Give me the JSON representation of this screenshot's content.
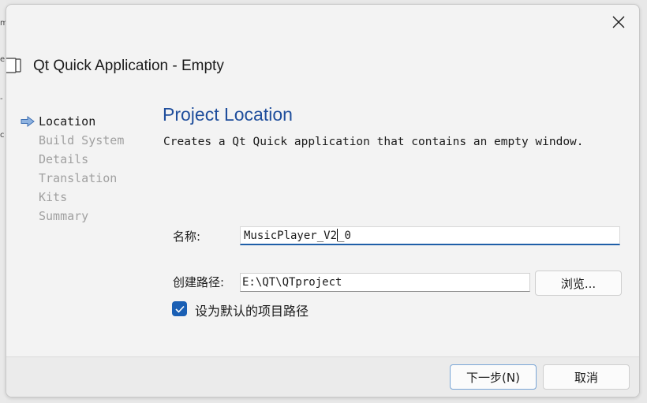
{
  "dialog": {
    "title": "Qt Quick Application - Empty"
  },
  "steps": [
    {
      "label": "Location",
      "active": true
    },
    {
      "label": "Build System",
      "active": false
    },
    {
      "label": "Details",
      "active": false
    },
    {
      "label": "Translation",
      "active": false
    },
    {
      "label": "Kits",
      "active": false
    },
    {
      "label": "Summary",
      "active": false
    }
  ],
  "page": {
    "title": "Project Location",
    "description": "Creates a Qt Quick application that contains an empty window."
  },
  "form": {
    "name_label": "名称:",
    "name_value_before_caret": "MusicPlayer_V2",
    "name_value_after_caret": "_0",
    "path_label": "创建路径:",
    "path_value": "E:\\QT\\QTproject",
    "browse_label": "浏览...",
    "default_path_label": "设为默认的项目路径",
    "default_path_checked": true
  },
  "footer": {
    "next_label": "下一步(N)",
    "cancel_label": "取消"
  },
  "colors": {
    "accent": "#1a5fb4",
    "title_blue": "#1f4e9c"
  }
}
